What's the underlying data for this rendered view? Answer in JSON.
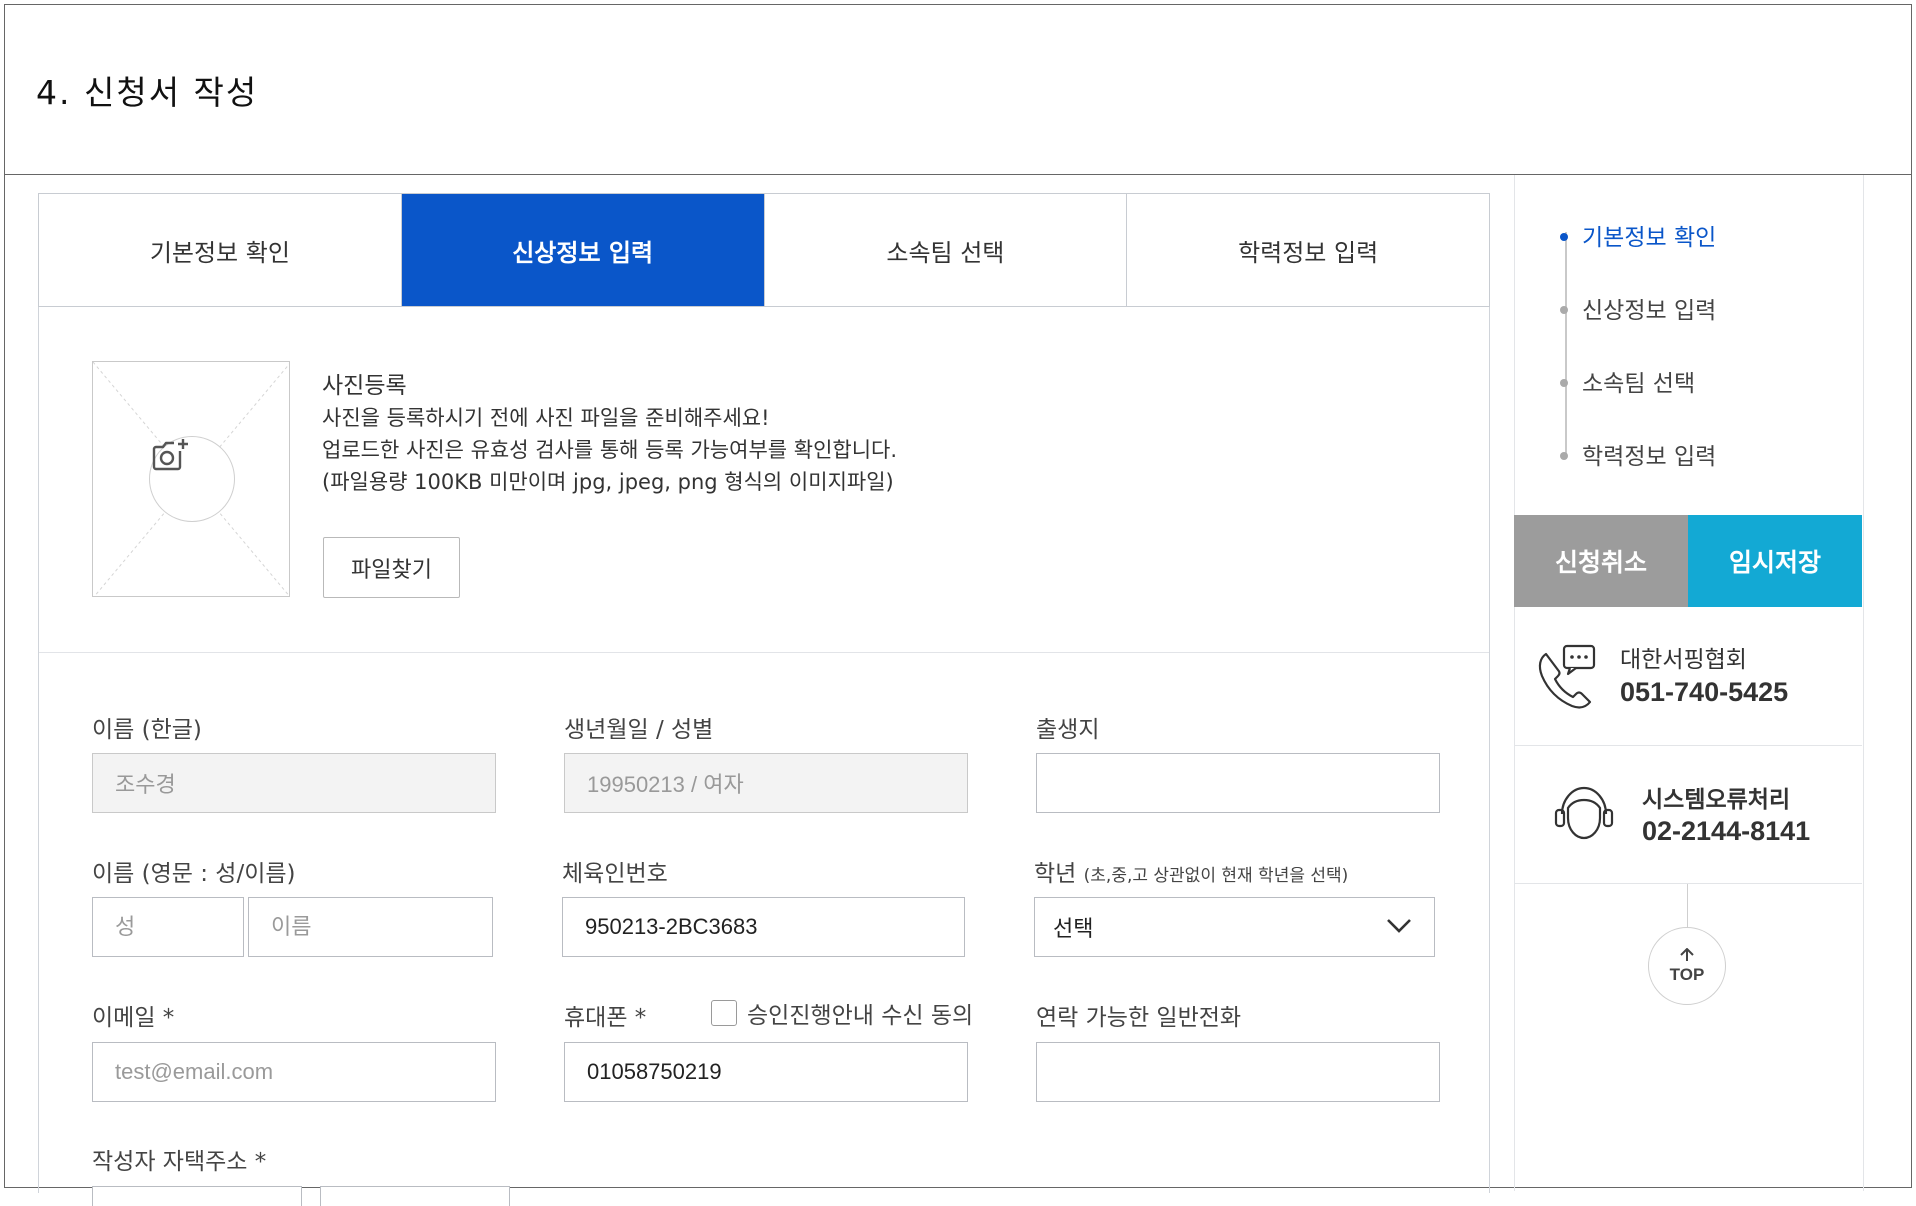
{
  "doc": {
    "title": "4. 신청서 작성"
  },
  "tabs": [
    {
      "label": "기본정보 확인",
      "active": false
    },
    {
      "label": "신상정보 입력",
      "active": true
    },
    {
      "label": "소속팀 선택",
      "active": false
    },
    {
      "label": "학력정보 입력",
      "active": false
    }
  ],
  "photo": {
    "title": "사진등록",
    "line1": "사진을 등록하시기 전에 사진 파일을 준비해주세요!",
    "line2": "업로드한 사진은 유효성 검사를 통해 등록 가능여부를 확인합니다.",
    "line3": "(파일용량 100KB 미만이며 jpg, jpeg, png 형식의 이미지파일)",
    "button": "파일찾기",
    "icon": "camera-add-icon"
  },
  "form": {
    "name_ko": {
      "label": "이름 (한글)",
      "value": "조수경"
    },
    "birth": {
      "label": "생년월일 / 성별",
      "value": "19950213 / 여자"
    },
    "birthplace": {
      "label": "출생지",
      "value": ""
    },
    "name_en": {
      "label": "이름 (영문 : 성/이름)",
      "last_placeholder": "성",
      "first_placeholder": "이름"
    },
    "athlete_no": {
      "label": "체육인번호",
      "value": "950213-2BC3683"
    },
    "grade": {
      "label": "학년",
      "note": "(초,중,고 상관없이 현재 학년을 선택)",
      "selected": "선택"
    },
    "email": {
      "label": "이메일 *",
      "placeholder": "test@email.com"
    },
    "mobile": {
      "label": "휴대폰 *",
      "value": "01058750219",
      "consent_label": "승인진행안내 수신 동의",
      "consent_checked": false
    },
    "phone": {
      "label": "연락 가능한 일반전화",
      "value": ""
    },
    "address": {
      "label": "작성자 자택주소 *"
    }
  },
  "sidebar": {
    "steps": [
      {
        "label": "기본정보 확인",
        "active": true
      },
      {
        "label": "신상정보 입력",
        "active": false
      },
      {
        "label": "소속팀 선택",
        "active": false
      },
      {
        "label": "학력정보 입력",
        "active": false
      }
    ],
    "cancel_label": "신청취소",
    "save_label": "임시저장",
    "contacts": [
      {
        "name": "대한서핑협회",
        "phone": "051-740-5425",
        "icon": "phone-chat-icon"
      },
      {
        "name": "시스템오류처리",
        "phone": "02-2144-8141",
        "icon": "headset-icon"
      }
    ],
    "top_label": "TOP"
  },
  "colors": {
    "primary": "#0a56c9",
    "save": "#13a9d4",
    "cancel": "#9c9c9c"
  }
}
